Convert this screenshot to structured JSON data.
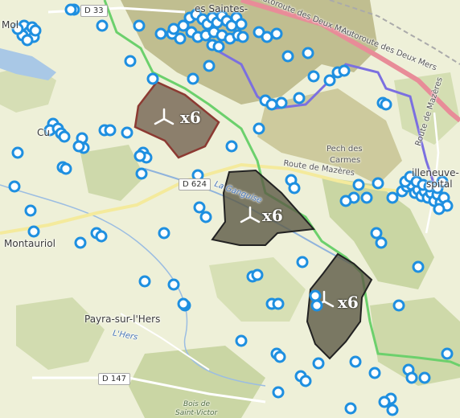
{
  "map": {
    "place_labels": [
      {
        "id": "place-molleville",
        "text": "Mol",
        "cls": "place"
      },
      {
        "id": "place-montferrand",
        "text": "Cu",
        "cls": "place"
      },
      {
        "id": "place-saintes",
        "text": "es Saintes-",
        "cls": "place"
      },
      {
        "id": "place-montauriol",
        "text": "Montauriol",
        "cls": "place"
      },
      {
        "id": "place-payra",
        "text": "Payra-sur-l'Hers",
        "cls": "place"
      },
      {
        "id": "place-villeneuve",
        "text": "illeneuve-",
        "cls": "place"
      },
      {
        "id": "place-villeneuve-2",
        "text": "spital",
        "cls": "place"
      },
      {
        "id": "place-pech",
        "text": "Pech des",
        "cls": "small"
      },
      {
        "id": "place-carmes",
        "text": "Carmes",
        "cls": "small"
      },
      {
        "id": "road-mazeres",
        "text": "Route de Mazères",
        "cls": "small"
      },
      {
        "id": "road-autoroute-1",
        "text": "Autoroute des Deux Mers",
        "cls": "small"
      },
      {
        "id": "road-autoroute-2",
        "text": "Autoroute des Deux Mers",
        "cls": "small"
      },
      {
        "id": "road-route-mazeres-v",
        "text": "Route de Mazères",
        "cls": "small"
      },
      {
        "id": "river-ganguise",
        "text": "La Ganguise",
        "cls": "river"
      },
      {
        "id": "river-hers",
        "text": "L'Hers",
        "cls": "river"
      },
      {
        "id": "wood-bois",
        "text": "Bois de",
        "cls": "wood"
      },
      {
        "id": "wood-saint-victor",
        "text": "Saint-Victor",
        "cls": "wood"
      }
    ],
    "road_shields": [
      {
        "id": "shield-d33",
        "text": "D 33"
      },
      {
        "id": "shield-d624",
        "text": "D 624"
      },
      {
        "id": "shield-d147",
        "text": "D 147"
      }
    ],
    "wind_farms": [
      {
        "id": "wind-farm-1",
        "count_label": "x6"
      },
      {
        "id": "wind-farm-2",
        "count_label": "x6"
      },
      {
        "id": "wind-farm-3",
        "count_label": "x6"
      }
    ],
    "colors": {
      "background": "#eef0d8",
      "forest": "#cbd7a4",
      "hill": "#b9b98a",
      "water": "#a9c8e6",
      "motorway": "#e88c98",
      "boundary_purple": "#7b6fe0",
      "boundary_green": "#6cd06c",
      "road_yellow": "#f4ea9c",
      "marker": "#1e8fe0",
      "wind_fill": "#5c5a46",
      "wind_stroke_red": "#8c3a32"
    }
  }
}
